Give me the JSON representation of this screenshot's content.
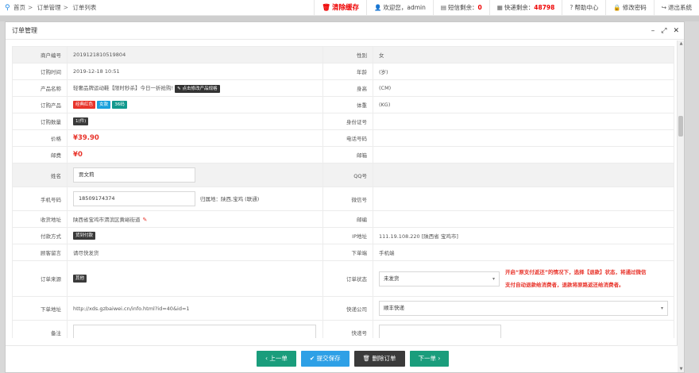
{
  "breadcrumb": [
    "首页",
    "订单管理",
    "订单列表"
  ],
  "topnav": {
    "clear_cache": "清除缓存",
    "welcome": "欢迎您，admin",
    "sms_label": "短信剩余：",
    "sms_count": "0",
    "express_label": "快递剩余：",
    "express_count": "48798",
    "help": "帮助中心",
    "change_password": "修改密码",
    "logout": "退出系统"
  },
  "modal": {
    "title": "订单管理"
  },
  "form": {
    "merchant_no_label": "商户编号",
    "merchant_no": "2019121810519804",
    "gender_label": "性别",
    "gender": "女",
    "order_time_label": "订购时间",
    "order_time": "2019-12-18 10:51",
    "age_label": "年龄",
    "age": "(岁)",
    "product_name_label": "产品名称",
    "product_name": "轻奢品牌运动鞋【限时秒杀】今日一折抢购!",
    "edit_spec_button": "点击修改产品规格",
    "height_label": "身高",
    "height": "(CM)",
    "order_product_label": "订购产品",
    "tags": [
      "经典红色",
      "女款",
      "36码"
    ],
    "weight_label": "体重",
    "weight": "(KG)",
    "quantity_label": "订购数量",
    "quantity": "1(件)",
    "id_label": "身份证号",
    "price_label": "价格",
    "price": "¥39.90",
    "phone_code_label": "电话号码",
    "shipping_label": "邮费",
    "shipping": "¥0",
    "mailbox_label": "邮箱",
    "name_label": "姓名",
    "name": "贾文莉",
    "qq_label": "QQ号",
    "mobile_label": "手机号码",
    "mobile": "18509174374",
    "mobile_geo": "归属地：陕西,宝鸡 (联通)",
    "wechat_label": "微信号",
    "address_label": "收货地址",
    "address": "陕西省宝鸡市渭滨区黄峪街道",
    "postcode_label": "邮编",
    "payment_label": "付款方式",
    "payment": "货到付款",
    "ip_label": "IP地址",
    "ip": "111.19.108.220 [陕西省 宝鸡市]",
    "remark_label": "顾客留言",
    "remark": "请尽快发货",
    "terminal_label": "下单端",
    "terminal": "手机端",
    "source_label": "订单来源",
    "source": "其他",
    "status_label": "订单状态",
    "status": "未发货",
    "status_note_1": "开启“原支付返还”的情况下，选择【退款】状态，将通过微信",
    "status_note_2": "支付自动退款给消费者，退款将原路返还给消费者。",
    "order_url_label": "下单地址",
    "order_url": "http://xds.gzbaiwei.cn/info.html?id=40&id=1",
    "courier_label": "快递公司",
    "courier": "顺丰快递",
    "note_label": "备注",
    "tracking_label": "快递号"
  },
  "buttons": {
    "prev": "上一单",
    "save": "提交保存",
    "delete": "删除订单",
    "next": "下一单"
  }
}
